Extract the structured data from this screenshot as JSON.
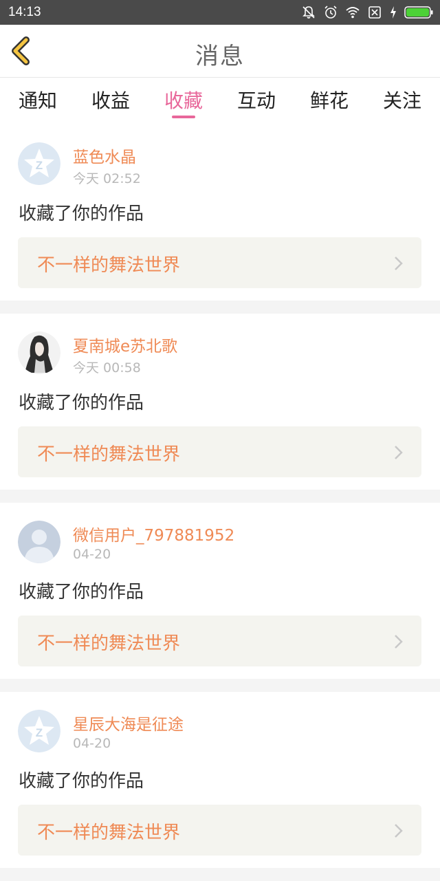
{
  "status_bar": {
    "time": "14:13",
    "icons": [
      "bell-off-icon",
      "alarm-icon",
      "wifi-icon",
      "sim-off-icon",
      "charging-icon",
      "battery-icon"
    ]
  },
  "header": {
    "title": "消息",
    "back_icon": "chevron-left-icon"
  },
  "tabs": [
    {
      "label": "通知",
      "active": false
    },
    {
      "label": "收益",
      "active": false
    },
    {
      "label": "收藏",
      "active": true
    },
    {
      "label": "互动",
      "active": false
    },
    {
      "label": "鲜花",
      "active": false
    },
    {
      "label": "关注",
      "active": false
    }
  ],
  "messages": [
    {
      "avatar": "qzone-avatar",
      "username": "蓝色水晶",
      "time": "今天 02:52",
      "action": "收藏了你的作品",
      "work_title": "不一样的舞法世界"
    },
    {
      "avatar": "girl-photo-avatar",
      "username": "夏南城e苏北歌",
      "time": "今天 00:58",
      "action": "收藏了你的作品",
      "work_title": "不一样的舞法世界"
    },
    {
      "avatar": "default-user-avatar",
      "username": "微信用户_797881952",
      "time": "04-20",
      "action": "收藏了你的作品",
      "work_title": "不一样的舞法世界"
    },
    {
      "avatar": "qzone-avatar",
      "username": "星辰大海是征途",
      "time": "04-20",
      "action": "收藏了你的作品",
      "work_title": "不一样的舞法世界"
    }
  ],
  "colors": {
    "accent_pink": "#e8679a",
    "username_orange": "#ef8a55",
    "back_icon_yellow": "#f5c542",
    "card_inner_bg": "#f4f4ef"
  }
}
